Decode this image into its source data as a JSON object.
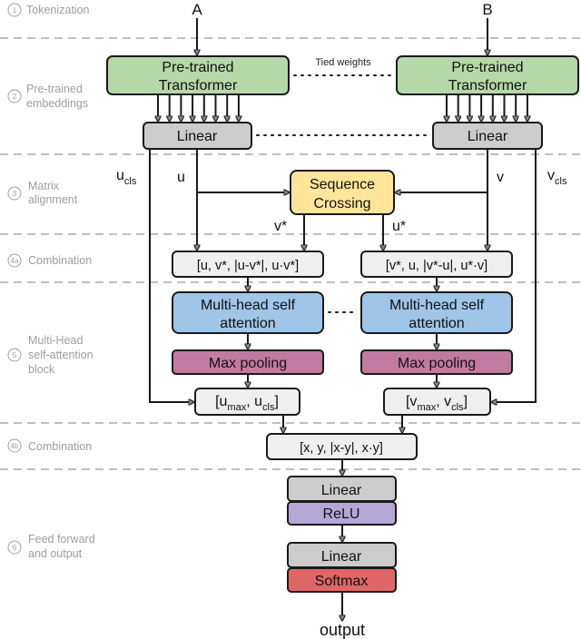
{
  "sections": [
    {
      "num": "1",
      "lines": [
        "Tokenization"
      ]
    },
    {
      "num": "2",
      "lines": [
        "Pre-trained",
        "embeddings"
      ]
    },
    {
      "num": "3",
      "lines": [
        "Matrix",
        "alignment"
      ]
    },
    {
      "num": "4a",
      "lines": [
        "Combination"
      ]
    },
    {
      "num": "5",
      "lines": [
        "Multi-Head",
        "self-attention",
        "block"
      ]
    },
    {
      "num": "4b",
      "lines": [
        "Combination"
      ]
    },
    {
      "num": "6",
      "lines": [
        "Feed forward",
        "and output"
      ]
    }
  ],
  "inputs": {
    "a": "A",
    "b": "B"
  },
  "transformer": {
    "line1": "Pre-trained",
    "line2": "Transformer"
  },
  "tied_weights": "Tied weights",
  "linear": "Linear",
  "vars": {
    "u": "u",
    "v": "v",
    "u_cls_base": "u",
    "v_cls_base": "v",
    "cls_sub": "cls",
    "v_star": "v*",
    "u_star": "u*"
  },
  "sequence_crossing": {
    "line1": "Sequence",
    "line2": "Crossing"
  },
  "combination_left": "[u, v*, |u-v*|, u·v*]",
  "combination_right": "[v*, u, |v*-u|, u*·v]",
  "mhsa": {
    "line1": "Multi-head self",
    "line2": "attention"
  },
  "max_pooling": "Max pooling",
  "pooled_left": {
    "open": "[u",
    "sub1": "max",
    "mid": ", u",
    "sub2": "cls",
    "close": "]"
  },
  "pooled_right": {
    "open": "[v",
    "sub1": "max",
    "mid": ", v",
    "sub2": "cls",
    "close": "]"
  },
  "combination_final": "[x, y, |x-y|, x·y]",
  "ffn": {
    "linear1": "Linear",
    "relu": "ReLU",
    "linear2": "Linear",
    "softmax": "Softmax"
  },
  "output": "output",
  "colors": {
    "transformer": "#b6d7a8",
    "linear": "#cccccc",
    "crossing": "#ffe599",
    "combination": "#efefef",
    "mhsa": "#9fc5e8",
    "pooling": "#c27ba0",
    "relu": "#b4a7d6",
    "softmax": "#e06666"
  }
}
